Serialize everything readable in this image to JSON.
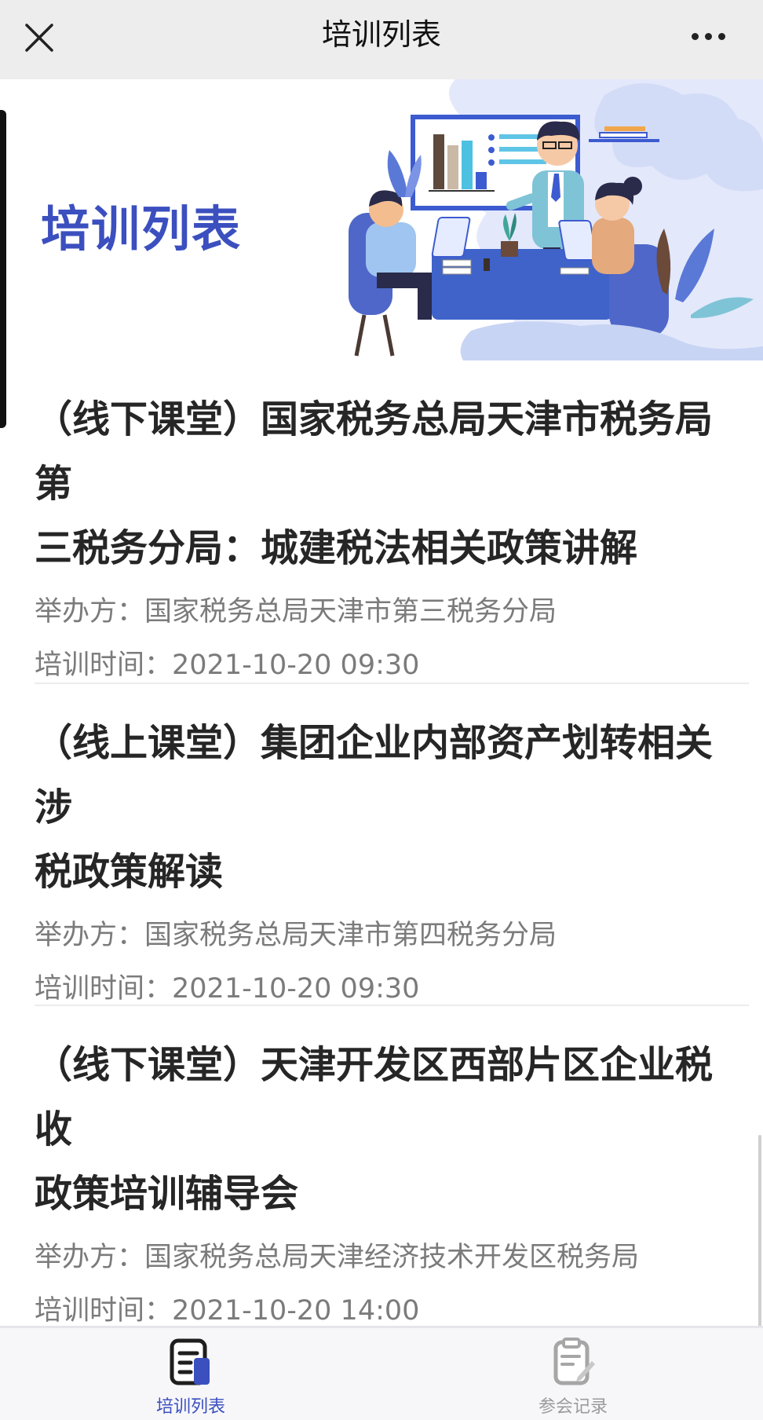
{
  "nav": {
    "title": "培训列表"
  },
  "banner": {
    "title": "培训列表"
  },
  "trainings": [
    {
      "title_line1": "（线下课堂）国家税务总局天津市税务局第",
      "title_line2": "三税务分局：城建税法相关政策讲解",
      "organizer_label": "举办方：",
      "organizer": "国家税务总局天津市第三税务分局",
      "time_label": "培训时间：",
      "time": "2021-10-20 09:30"
    },
    {
      "title_line1": "（线上课堂）集团企业内部资产划转相关涉",
      "title_line2": "税政策解读",
      "organizer_label": "举办方：",
      "organizer": "国家税务总局天津市第四税务分局",
      "time_label": "培训时间：",
      "time": "2021-10-20 09:30"
    },
    {
      "title_line1": "（线下课堂）天津开发区西部片区企业税收",
      "title_line2": "政策培训辅导会",
      "organizer_label": "举办方：",
      "organizer": "国家税务总局天津经济技术开发区税务局",
      "time_label": "培训时间：",
      "time": "2021-10-20 14:00"
    }
  ],
  "tabbar": {
    "tabs": [
      {
        "label": "培训列表",
        "icon": "document-list-icon",
        "active": true
      },
      {
        "label": "参会记录",
        "icon": "clipboard-edit-icon",
        "active": false
      }
    ]
  },
  "colors": {
    "accent": "#3b4fbf",
    "nav_bg": "#ededed",
    "title_text": "#262626",
    "meta_text": "#7b7b7b",
    "inactive_tab": "#9b9b9b"
  }
}
